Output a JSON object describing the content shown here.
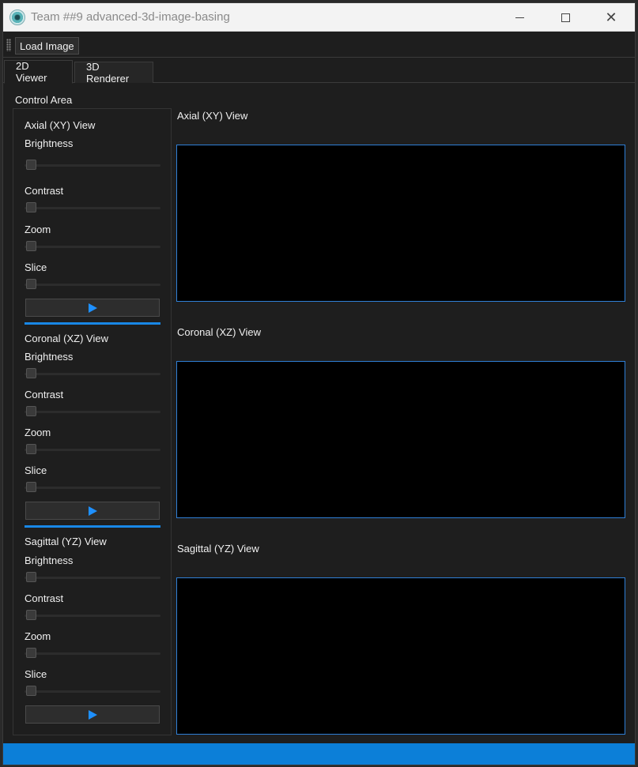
{
  "window": {
    "title": "Team ##9 advanced-3d-image-basing",
    "controls": {
      "minimize": "minimize-icon",
      "maximize": "maximize-icon",
      "close": "close-icon"
    }
  },
  "toolbar": {
    "load_image_label": "Load Image"
  },
  "tabs": [
    {
      "label": "2D Viewer",
      "active": true
    },
    {
      "label": "3D Renderer",
      "active": false
    }
  ],
  "control_area": {
    "title": "Control Area",
    "groups": [
      {
        "title": "Axial (XY) View",
        "sliders": [
          {
            "label": "Brightness",
            "value": 0
          },
          {
            "label": "Contrast",
            "value": 0
          },
          {
            "label": "Zoom",
            "value": 0
          },
          {
            "label": "Slice",
            "value": 0
          }
        ],
        "play_icon": "play-icon"
      },
      {
        "title": "Coronal (XZ) View",
        "sliders": [
          {
            "label": "Brightness",
            "value": 0
          },
          {
            "label": "Contrast",
            "value": 0
          },
          {
            "label": "Zoom",
            "value": 0
          },
          {
            "label": "Slice",
            "value": 0
          }
        ],
        "play_icon": "play-icon"
      },
      {
        "title": "Sagittal (YZ) View",
        "sliders": [
          {
            "label": "Brightness",
            "value": 0
          },
          {
            "label": "Contrast",
            "value": 0
          },
          {
            "label": "Zoom",
            "value": 0
          },
          {
            "label": "Slice",
            "value": 0
          }
        ],
        "play_icon": "play-icon"
      }
    ]
  },
  "views": [
    {
      "title": "Axial (XY) View"
    },
    {
      "title": "Coronal (XZ) View"
    },
    {
      "title": "Sagittal (YZ) View"
    }
  ],
  "colors": {
    "accent": "#0c7fd8",
    "view_border": "#2f7fd6",
    "play": "#1e90ff"
  }
}
